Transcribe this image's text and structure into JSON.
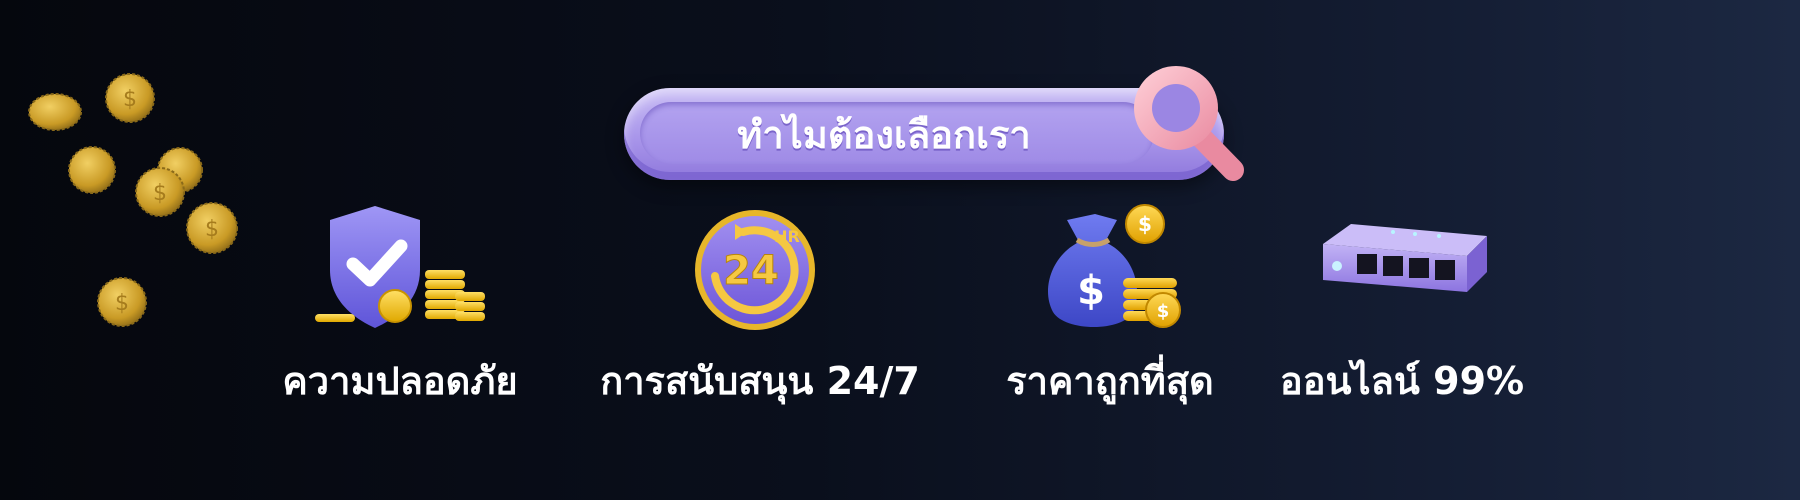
{
  "header": {
    "title": "ทำไมต้องเลือกเรา"
  },
  "features": [
    {
      "label": "ความปลอดภัย",
      "icon": "shield-check-coins-icon"
    },
    {
      "label": "การสนับสนุน 24/7",
      "icon": "24hr-support-icon"
    },
    {
      "label": "ราคาถูกที่สุด",
      "icon": "money-bag-coins-icon"
    },
    {
      "label": "ออนไลน์ 99%",
      "icon": "network-switch-icon"
    }
  ],
  "colors": {
    "background": "#0a0f1c",
    "pill": "#a895ea",
    "magnifier": "#f4a9b8",
    "coin": "#e9b838",
    "text": "#ffffff"
  }
}
